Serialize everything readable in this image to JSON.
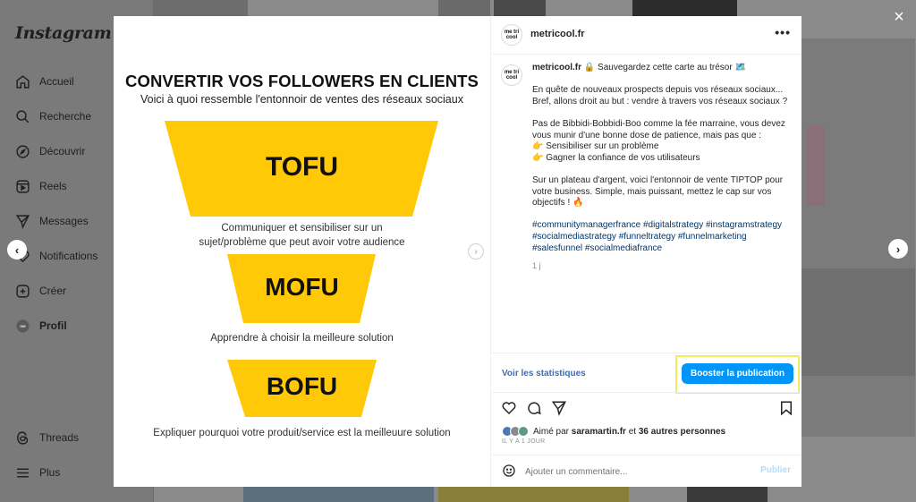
{
  "sidebar": {
    "logo": "Instagram",
    "items": [
      {
        "label": "Accueil",
        "icon": "home-icon"
      },
      {
        "label": "Recherche",
        "icon": "search-icon"
      },
      {
        "label": "Découvrir",
        "icon": "compass-icon"
      },
      {
        "label": "Reels",
        "icon": "reels-icon"
      },
      {
        "label": "Messages",
        "icon": "send-icon"
      },
      {
        "label": "Notifications",
        "icon": "heart-icon"
      },
      {
        "label": "Créer",
        "icon": "plus-square-icon"
      },
      {
        "label": "Profil",
        "icon": "avatar-icon"
      },
      {
        "label": "Threads",
        "icon": "threads-icon"
      },
      {
        "label": "Plus",
        "icon": "menu-icon"
      }
    ]
  },
  "post_image": {
    "title": "CONVERTIR VOS FOLLOWERS EN CLIENTS",
    "subtitle": "Voici à quoi ressemble l'entonnoir de ventes des réseaux sociaux",
    "funnel_color": "#FFC907",
    "stages": [
      {
        "label": "TOFU",
        "caption_line1": "Communiquer et sensibiliser sur un",
        "caption_line2": "sujet/problème que peut avoir votre audience"
      },
      {
        "label": "MOFU",
        "caption_line1": "Apprendre à choisir la meilleure solution",
        "caption_line2": ""
      },
      {
        "label": "BOFU",
        "caption_line1": "Expliquer pourquoi votre produit/service est la meilleuure solution",
        "caption_line2": ""
      }
    ]
  },
  "panel": {
    "username": "metricool.fr",
    "avatar_text": "me tri cool",
    "more_icon": "more-horizontal-icon",
    "caption": {
      "user": "metricool.fr",
      "line_intro": "🔒 Sauvegardez cette carte au trésor 🗺️",
      "para1": "En quête de nouveaux prospects depuis vos réseaux sociaux... Bref, allons droit au but : vendre à travers vos réseaux sociaux ?",
      "para2_intro": "Pas de Bibbidi-Bobbidi-Boo comme la fée marraine, vous devez vous munir d'une bonne dose de patience, mais pas que :",
      "bullet1": "👉 Sensibiliser sur un problème",
      "bullet2": "👉 Gagner la confiance de vos utilisateurs",
      "para3": "Sur un plateau d'argent, voici l'entonnoir de vente TIPTOP pour votre business. Simple, mais puissant, mettez le cap sur vos objectifs ! 🔥",
      "hashtags": "#communitymanagerfrance #digitalstrategy #instagramstrategy #socialmediastrategy #funneltrategy #funnelmarketing #salesfunnel #socialmediafrance",
      "time": "1 j"
    },
    "stats_link": "Voir les statistiques",
    "boost_label": "Booster la publication",
    "likes_prefix": "Aimé par ",
    "likes_user": "saramartin.fr",
    "likes_middle": " et ",
    "likes_others": "36 autres personnes",
    "post_time": "IL Y A 1 JOUR",
    "comment_placeholder": "Ajouter un commentaire...",
    "publish_label": "Publier"
  },
  "overlay": {
    "close_icon": "×",
    "prev_icon": "‹",
    "next_icon": "›"
  }
}
